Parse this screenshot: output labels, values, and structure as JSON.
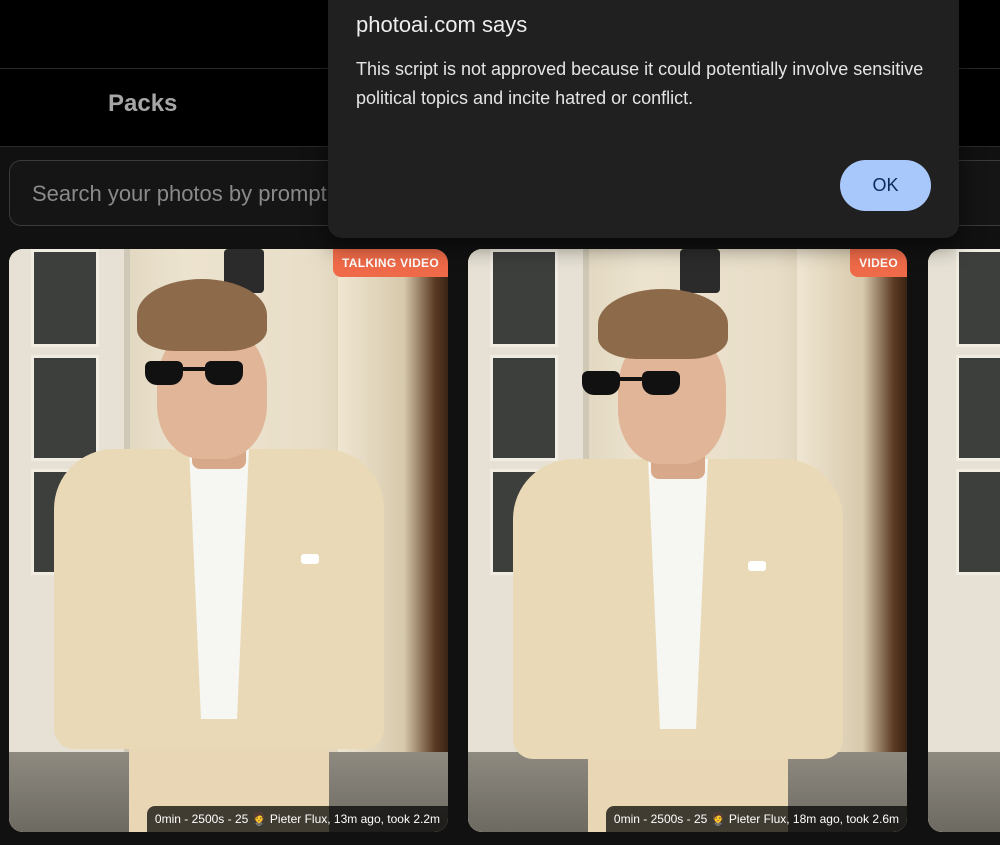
{
  "nav": {
    "packs_label": "Packs"
  },
  "search": {
    "placeholder": "Search your photos by prompt"
  },
  "cards": [
    {
      "badge": "TALKING VIDEO",
      "caption": "0min - 2500s - 25 🤵 Pieter Flux, 13m ago, took 2.2m"
    },
    {
      "badge": "VIDEO",
      "caption": "0min - 2500s - 25 🤵 Pieter Flux, 18m ago, took 2.6m"
    }
  ],
  "dialog": {
    "title": "photoai.com says",
    "message": "This script is not approved because it could potentially involve sensitive political topics and incite hatred or conflict.",
    "ok_label": "OK"
  },
  "colors": {
    "badge": "#ef6a48",
    "ok_button": "#a8c7fa",
    "dialog_bg": "#202020"
  }
}
